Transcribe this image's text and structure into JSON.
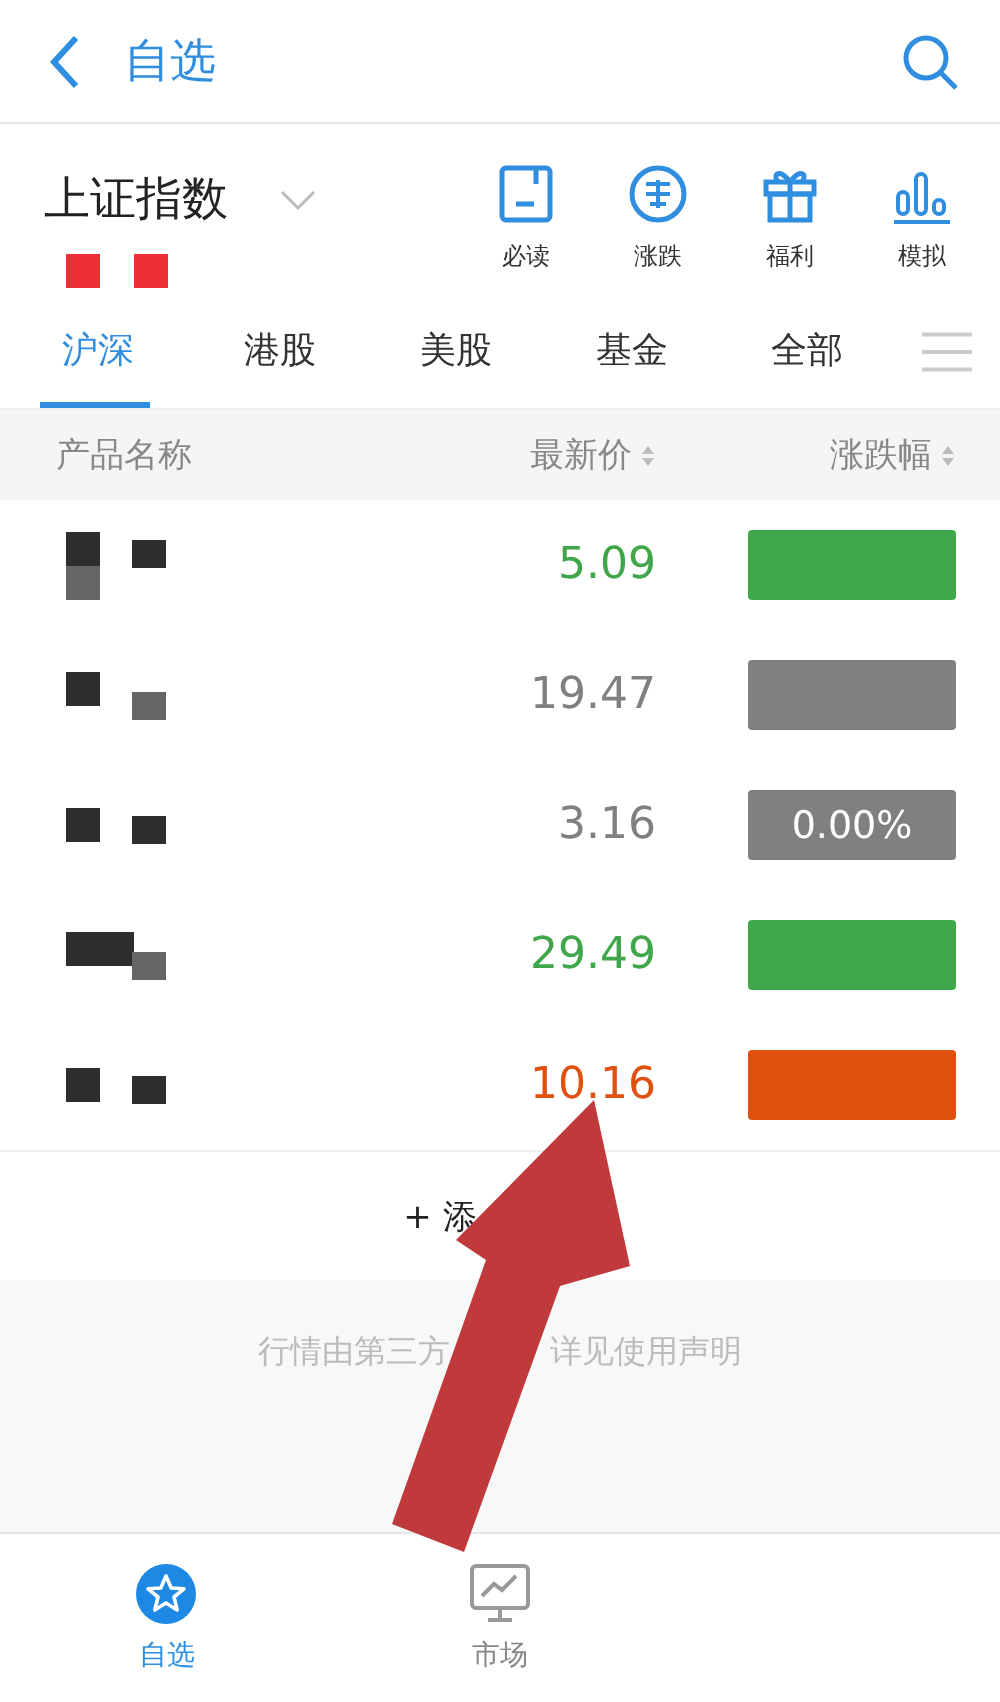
{
  "header": {
    "title": "自选"
  },
  "index": {
    "name": "上证指数"
  },
  "shortcuts": [
    {
      "label": "必读",
      "kind": "doc"
    },
    {
      "label": "涨跌",
      "kind": "guess"
    },
    {
      "label": "福利",
      "kind": "gift"
    },
    {
      "label": "模拟",
      "kind": "bars"
    }
  ],
  "tabs": [
    {
      "label": "沪深",
      "selected": true
    },
    {
      "label": "港股",
      "selected": false
    },
    {
      "label": "美股",
      "selected": false
    },
    {
      "label": "基金",
      "selected": false
    },
    {
      "label": "全部",
      "selected": false
    }
  ],
  "table": {
    "columns": [
      "产品名称",
      "最新价",
      "涨跌幅"
    ],
    "rows": [
      {
        "price": "5.09",
        "color": "#3fa64a"
      },
      {
        "price": "19.47",
        "color": "#808080"
      },
      {
        "price": "3.16",
        "color": "#808080",
        "change": "0.00%"
      },
      {
        "price": "29.49",
        "color": "#3fa64a"
      },
      {
        "price": "10.16",
        "color": "#e0500f"
      }
    ]
  },
  "add_button": {
    "label": "+ 添"
  },
  "disclaimer": [
    "行情由第三方",
    "详见使用声明"
  ],
  "nav": [
    {
      "label": "自选",
      "kind": "star",
      "selected": true
    },
    {
      "label": "市场",
      "kind": "monitor",
      "selected": false
    }
  ]
}
